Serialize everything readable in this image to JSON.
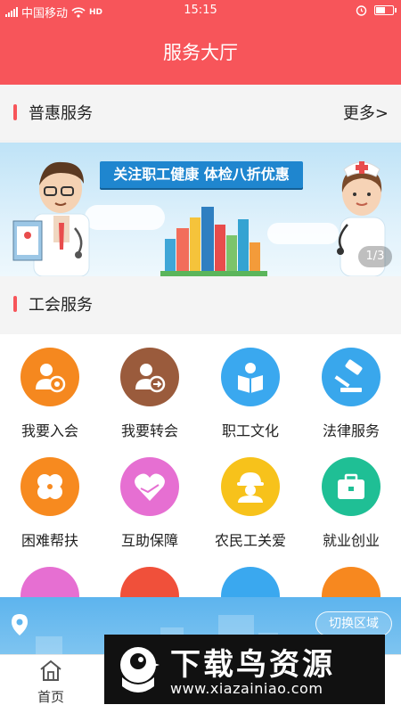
{
  "status_bar": {
    "carrier": "中国移动",
    "network": "HD",
    "time": "15:15",
    "icons": [
      "signal-icon",
      "wifi-icon",
      "alarm-icon",
      "battery-icon"
    ]
  },
  "header": {
    "title": "服务大厅"
  },
  "puhui_section": {
    "title": "普惠服务",
    "more_label": "更多>"
  },
  "banner": {
    "headline": "关注职工健康 体检八折优惠",
    "pager": "1/3",
    "slide_index": 1,
    "slide_count": 3
  },
  "union_section": {
    "title": "工会服务",
    "items": [
      {
        "label": "我要入会",
        "icon": "member-join-icon",
        "color": "#f5881f"
      },
      {
        "label": "我要转会",
        "icon": "member-transfer-icon",
        "color": "#9a5b3c"
      },
      {
        "label": "职工文化",
        "icon": "reading-icon",
        "color": "#3aa8ef"
      },
      {
        "label": "法律服务",
        "icon": "gavel-icon",
        "color": "#39a7ec"
      },
      {
        "label": "困难帮扶",
        "icon": "clover-icon",
        "color": "#f78a1f"
      },
      {
        "label": "互助保障",
        "icon": "heart-hands-icon",
        "color": "#e66fd2"
      },
      {
        "label": "农民工关爱",
        "icon": "worker-helmet-icon",
        "color": "#f7c21b"
      },
      {
        "label": "就业创业",
        "icon": "briefcase-icon",
        "color": "#1fbf95"
      },
      {
        "label": "",
        "icon": "person-icon",
        "color": "#e66fd2"
      },
      {
        "label": "",
        "icon": "heart-icon",
        "color": "#f0503a"
      },
      {
        "label": "",
        "icon": "picture-icon",
        "color": "#3aa8ef"
      },
      {
        "label": "",
        "icon": "document-icon",
        "color": "#f7881f"
      }
    ]
  },
  "region": {
    "switch_label": "切换区域",
    "icon": "location-pin-icon"
  },
  "tab_bar": {
    "home_label": "首页",
    "home_icon": "home-icon"
  },
  "watermark": {
    "title": "下载鸟资源",
    "url": "www.xiazainiao.com"
  },
  "colors": {
    "brand": "#f7555a",
    "banner_text_bg": "#1f86cf",
    "region_bar": "#5db4ee"
  }
}
